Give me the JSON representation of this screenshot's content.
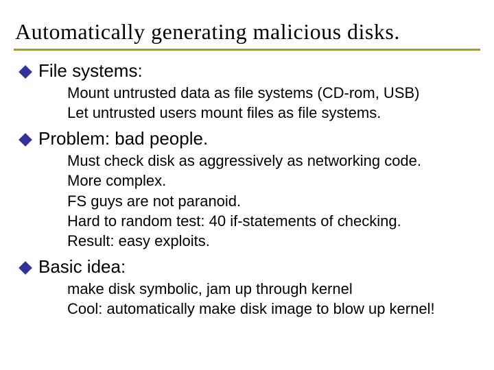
{
  "title": "Automatically generating malicious disks.",
  "sections": [
    {
      "heading": "File systems:",
      "items": [
        "Mount untrusted data as file systems (CD-rom, USB)",
        "Let untrusted users mount files as file systems."
      ]
    },
    {
      "heading": "Problem: bad people.",
      "items": [
        "Must check disk as aggressively as networking code.",
        "More complex.",
        "FS guys are not paranoid.",
        "Hard to random test: 40 if-statements of checking.",
        "Result: easy exploits."
      ]
    },
    {
      "heading": "Basic idea:",
      "items": [
        "make disk symbolic, jam up through kernel",
        "Cool: automatically make disk image to blow up kernel!"
      ]
    }
  ]
}
